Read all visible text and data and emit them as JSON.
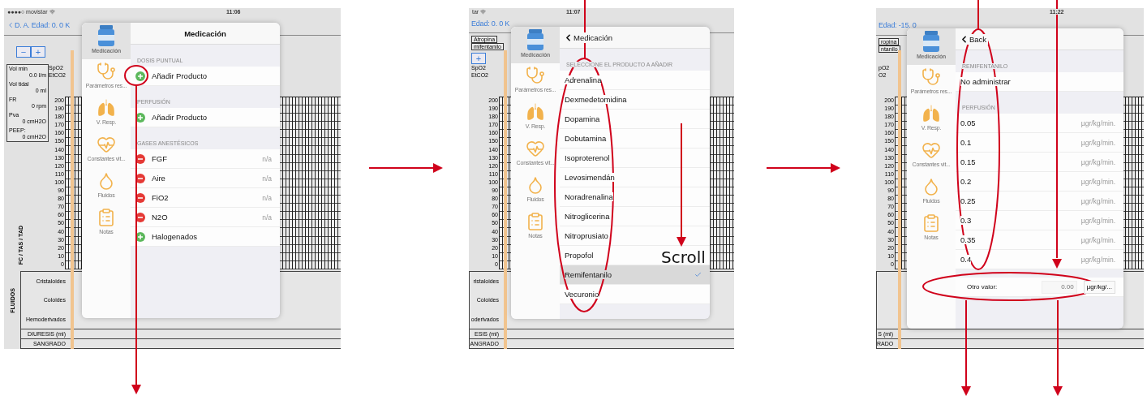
{
  "screens": [
    {
      "carrier": "●●●●○ movistar",
      "time": "11:06",
      "back": true,
      "nav_title": "D. A. Edad: 0. 0 K",
      "zoom_buttons": [
        "−",
        "+"
      ],
      "vitals": [
        {
          "label": "Vol min",
          "value": "0.0 l/m"
        },
        {
          "label": "Vol tidal",
          "value": "0 ml"
        },
        {
          "label": "FR",
          "value": "0 rpm"
        },
        {
          "label": "Pva",
          "value": "0 cmH2O"
        },
        {
          "label": "PEEP:",
          "value": "0 cmH2O"
        }
      ],
      "axis_labels": [
        "SpO2",
        "EtCO2"
      ],
      "y_axis": [
        "200",
        "190",
        "180",
        "170",
        "160",
        "150",
        "140",
        "130",
        "120",
        "110",
        "100",
        "90",
        "80",
        "70",
        "60",
        "50",
        "40",
        "30",
        "20",
        "10",
        "0"
      ],
      "axis_title": "FC / TAS / TAD",
      "fluids": {
        "title": "FLUIDOS",
        "rows": [
          "Cristaloides",
          "Coloides",
          "Hemoderivados"
        ]
      },
      "footer_rows": [
        "DIURESIS (ml)",
        "SANGRADO"
      ],
      "popover": {
        "back": false,
        "title": "Medicación",
        "sidebar": [
          {
            "label": "Medicación",
            "selected": true
          },
          {
            "label": "Parámetros res...",
            "selected": false
          },
          {
            "label": "V. Resp.",
            "selected": false
          },
          {
            "label": "Constantes vit...",
            "selected": false
          },
          {
            "label": "Fluidos",
            "selected": false
          },
          {
            "label": "Notas",
            "selected": false
          }
        ],
        "sections": [
          {
            "header": "DOSIS PUNTUAL",
            "rows": [
              {
                "kind": "add",
                "label": "Añadir Producto"
              }
            ]
          },
          {
            "header": "PERFUSIÓN",
            "rows": [
              {
                "kind": "add",
                "label": "Añadir Producto"
              }
            ]
          },
          {
            "header": "GASES ANESTÉSICOS",
            "rows": [
              {
                "kind": "remove",
                "label": "FGF",
                "value": "n/a"
              },
              {
                "kind": "remove",
                "label": "Aire",
                "value": "n/a"
              },
              {
                "kind": "remove",
                "label": "FiO2",
                "value": "n/a"
              },
              {
                "kind": "remove",
                "label": "N2O",
                "value": "n/a"
              },
              {
                "kind": "add",
                "label": "Halogenados"
              }
            ]
          }
        ]
      }
    },
    {
      "carrier": "tar",
      "time": "11:07",
      "back": false,
      "nav_title": "Edad: 0. 0 K",
      "drug_tags": [
        "Atropina",
        "mifentanilo"
      ],
      "zoom_buttons": [
        "+"
      ],
      "axis_labels": [
        "SpO2",
        "EtCO2"
      ],
      "y_axis": [
        "200",
        "190",
        "180",
        "170",
        "160",
        "150",
        "140",
        "130",
        "120",
        "110",
        "100",
        "90",
        "80",
        "70",
        "60",
        "50",
        "40",
        "30",
        "20",
        "10",
        "0"
      ],
      "fluids": {
        "rows": [
          "ristaloides",
          "Coloides",
          "oderivados"
        ]
      },
      "footer_rows": [
        "ESIS (ml)",
        "ANGRADO"
      ],
      "popover": {
        "back": true,
        "title": "Medicación",
        "sidebar": [
          {
            "label": "Medicación",
            "selected": true
          },
          {
            "label": "Parámetros res...",
            "selected": false
          },
          {
            "label": "V. Resp.",
            "selected": false
          },
          {
            "label": "Constantes vit...",
            "selected": false
          },
          {
            "label": "Fluidos",
            "selected": false
          },
          {
            "label": "Notas",
            "selected": false
          }
        ],
        "sections": [
          {
            "header": "SELECCIONE EL PRODUCTO A AÑADIR",
            "rows": [
              {
                "kind": "option",
                "label": "Adrenalina",
                "selected": false
              },
              {
                "kind": "option",
                "label": "Dexmedetomidina",
                "selected": false
              },
              {
                "kind": "option",
                "label": "Dopamina",
                "selected": false
              },
              {
                "kind": "option",
                "label": "Dobutamina",
                "selected": false
              },
              {
                "kind": "option",
                "label": "Isoproterenol",
                "selected": false
              },
              {
                "kind": "option",
                "label": "Levosimendán",
                "selected": false
              },
              {
                "kind": "option",
                "label": "Noradrenalina",
                "selected": false
              },
              {
                "kind": "option",
                "label": "Nitroglicerina",
                "selected": false
              },
              {
                "kind": "option",
                "label": "Nitroprusiato",
                "selected": false
              },
              {
                "kind": "option",
                "label": "Propofol",
                "selected": false
              },
              {
                "kind": "option",
                "label": "Remifentanilo",
                "selected": true
              },
              {
                "kind": "option",
                "label": "Vecuronio",
                "selected": false
              }
            ]
          }
        ]
      }
    },
    {
      "time": "11:22",
      "back": false,
      "nav_title": "Edad: -15. 0",
      "drug_tags": [
        "ropina",
        "ntanilo"
      ],
      "axis_labels": [
        "pO2",
        "O2"
      ],
      "y_axis": [
        "200",
        "190",
        "180",
        "170",
        "160",
        "150",
        "140",
        "130",
        "120",
        "110",
        "100",
        "90",
        "80",
        "70",
        "60",
        "50",
        "40",
        "30",
        "20",
        "10",
        "0"
      ],
      "footer_rows": [
        "S (ml)",
        "RADO"
      ],
      "popover": {
        "back": true,
        "title": "Back",
        "sidebar": [
          {
            "label": "Medicación",
            "selected": true
          },
          {
            "label": "Parámetros res...",
            "selected": false
          },
          {
            "label": "V. Resp.",
            "selected": false
          },
          {
            "label": "Constantes vit...",
            "selected": false
          },
          {
            "label": "Fluidos",
            "selected": false
          },
          {
            "label": "Notas",
            "selected": false
          }
        ],
        "sections": [
          {
            "header": "REMIFENTANILO",
            "rows": [
              {
                "kind": "dose",
                "label": "No administrar"
              }
            ]
          },
          {
            "header": "PERFUSIÓN",
            "rows": [
              {
                "kind": "dose",
                "label": "0.05",
                "unit": "µgr/kg/min."
              },
              {
                "kind": "dose",
                "label": "0.1",
                "unit": "µgr/kg/min."
              },
              {
                "kind": "dose",
                "label": "0.15",
                "unit": "µgr/kg/min."
              },
              {
                "kind": "dose",
                "label": "0.2",
                "unit": "µgr/kg/min."
              },
              {
                "kind": "dose",
                "label": "0.25",
                "unit": "µgr/kg/min."
              },
              {
                "kind": "dose",
                "label": "0.3",
                "unit": "µgr/kg/min."
              },
              {
                "kind": "dose",
                "label": "0.35",
                "unit": "µgr/kg/min."
              },
              {
                "kind": "dose",
                "label": "0.4",
                "unit": "µgr/kg/min."
              }
            ]
          },
          {
            "rows": [
              {
                "kind": "custom",
                "label": "Otro valor:",
                "placeholder": "0.00",
                "unit": "µgr/kg/..."
              }
            ]
          }
        ]
      }
    }
  ],
  "annotations": {
    "scroll_label": "Scroll"
  }
}
